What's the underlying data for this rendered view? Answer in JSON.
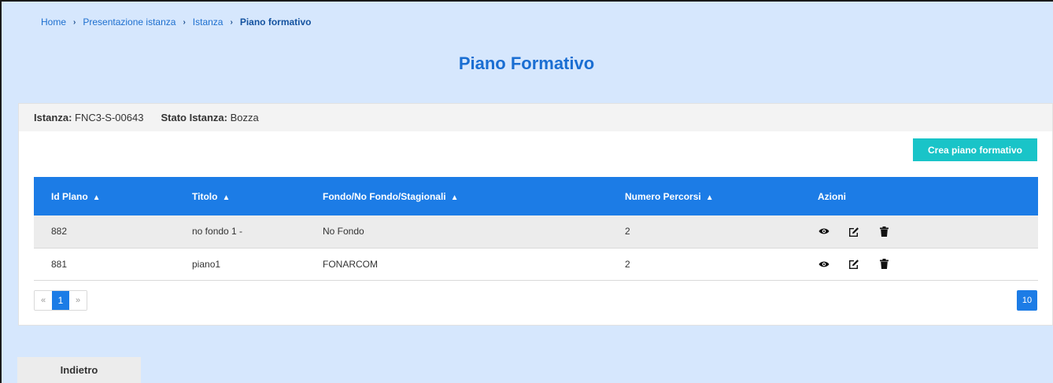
{
  "breadcrumb": {
    "items": [
      "Home",
      "Presentazione istanza",
      "Istanza"
    ],
    "current": "Piano formativo",
    "separator": "›"
  },
  "page": {
    "title": "Piano Formativo"
  },
  "info": {
    "istanza_label": "Istanza:",
    "istanza_value": "FNC3-S-00643",
    "stato_label": "Stato Istanza:",
    "stato_value": "Bozza"
  },
  "toolbar": {
    "create_label": "Crea piano formativo"
  },
  "table": {
    "columns": [
      "Id Plano",
      "Titolo",
      "Fondo/No Fondo/Stagionali",
      "Numero Percorsi",
      "Azioni"
    ],
    "sort_icon": "sort-icon",
    "rows": [
      {
        "id": "882",
        "titolo": "no fondo 1 -",
        "fondo": "No Fondo",
        "percorsi": "2"
      },
      {
        "id": "881",
        "titolo": "piano1",
        "fondo": "FONARCOM",
        "percorsi": "2"
      }
    ],
    "action_icons": [
      "eye-icon",
      "edit-icon",
      "trash-icon"
    ]
  },
  "pagination": {
    "prev": "«",
    "current": "1",
    "next": "»",
    "page_size": "10"
  },
  "footer": {
    "back_label": "Indietro"
  },
  "colors": {
    "background": "#d6e7fd",
    "title": "#1a6ed2",
    "table_header": "#1c7ce6",
    "create_button": "#19c4c8"
  }
}
